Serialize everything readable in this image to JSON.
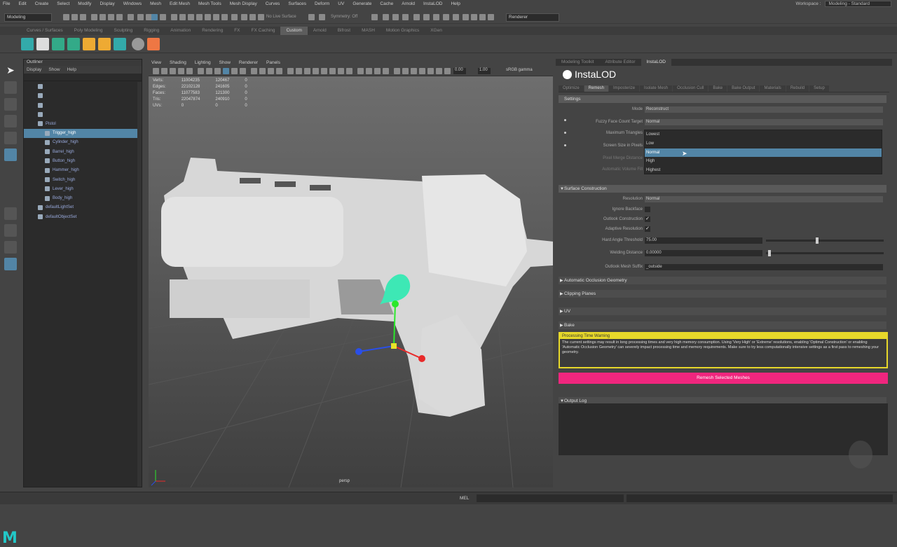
{
  "menubar": [
    "File",
    "Edit",
    "Create",
    "Select",
    "Modify",
    "Display",
    "Windows",
    "Mesh",
    "Edit Mesh",
    "Mesh Tools",
    "Mesh Display",
    "Curves",
    "Surfaces",
    "Deform",
    "UV",
    "Generate",
    "Cache",
    "Arnold",
    "InstaLOD",
    "Help"
  ],
  "workspace": {
    "label": "Workspace :",
    "value": "Modeling - Standard"
  },
  "statusline": {
    "mode": "Modeling",
    "no_live": "No Live Surface",
    "symmetry": "Symmetry: Off",
    "renderer": "Renderer"
  },
  "shelf_tabs": [
    "Curves / Surfaces",
    "Poly Modeling",
    "Sculpting",
    "Rigging",
    "Animation",
    "Rendering",
    "FX",
    "FX Caching",
    "Custom",
    "Arnold",
    "Bifrost",
    "MASH",
    "Motion Graphics",
    "XGen"
  ],
  "shelf_active": "Custom",
  "outliner": {
    "title": "Outliner",
    "menu": [
      "Display",
      "Show",
      "Help"
    ],
    "items": [
      {
        "label": "",
        "indent": 1,
        "selected": false
      },
      {
        "label": "",
        "indent": 1,
        "selected": false
      },
      {
        "label": "",
        "indent": 1,
        "selected": false
      },
      {
        "label": "",
        "indent": 1,
        "selected": false
      },
      {
        "label": "Pistol",
        "indent": 1,
        "selected": false
      },
      {
        "label": "Trigger_high",
        "indent": 2,
        "selected": true
      },
      {
        "label": "Cylinder_high",
        "indent": 2,
        "selected": false
      },
      {
        "label": "Barrel_high",
        "indent": 2,
        "selected": false
      },
      {
        "label": "Button_high",
        "indent": 2,
        "selected": false
      },
      {
        "label": "Hammer_high",
        "indent": 2,
        "selected": false
      },
      {
        "label": "Switch_high",
        "indent": 2,
        "selected": false
      },
      {
        "label": "Lever_high",
        "indent": 2,
        "selected": false
      },
      {
        "label": "Body_high",
        "indent": 2,
        "selected": false
      },
      {
        "label": "defaultLightSet",
        "indent": 1,
        "selected": false
      },
      {
        "label": "defaultObjectSet",
        "indent": 1,
        "selected": false
      }
    ]
  },
  "viewport": {
    "menu": [
      "View",
      "Shading",
      "Lighting",
      "Show",
      "Renderer",
      "Panels"
    ],
    "gamma": "sRGB gamma",
    "field1": "0.00",
    "field2": "1.00",
    "hud": [
      {
        "label": "Verts:",
        "a": "11004235",
        "b": "120467",
        "c": "0"
      },
      {
        "label": "Edges:",
        "a": "22102128",
        "b": "241605",
        "c": "0"
      },
      {
        "label": "Faces:",
        "a": "11077583",
        "b": "121300",
        "c": "0"
      },
      {
        "label": "Tris:",
        "a": "22047874",
        "b": "240910",
        "c": "0"
      },
      {
        "label": "UVs:",
        "a": "0",
        "b": "0",
        "c": "0"
      }
    ],
    "camera": "persp"
  },
  "right_panel": {
    "tabs": [
      "Modeling Toolkit",
      "Attribute Editor",
      "InstaLOD"
    ],
    "active_tab": "InstaLOD",
    "logo": "InstaLOD",
    "tool_tabs": [
      "Optimize",
      "Remesh",
      "Imposterize",
      "Isolate Mesh",
      "Occlusion Cull",
      "Bake",
      "Bake Output",
      "Materials",
      "Rebuild",
      "Setup"
    ],
    "active_tool_tab": "Remesh",
    "settings_title": "Settings",
    "mode_label": "Mode",
    "mode_value": "Reconstruct",
    "fuzzy_label": "Fuzzy Face Count Target",
    "fuzzy_value": "Normal",
    "max_tri_label": "Maximum Triangles",
    "screen_size_label": "Screen Size in Pixels",
    "pixel_merge_label": "Pixel Merge Distance",
    "auto_weld_label": "Automatic Volume Fill",
    "dropdown_options": [
      "Lowest",
      "Low",
      "Normal",
      "High",
      "Highest"
    ],
    "dropdown_highlight": "Normal",
    "surface_section": "Surface Construction",
    "resolution_label": "Resolution",
    "resolution_value": "Normal",
    "ignore_backface_label": "Ignore Backface",
    "outlook_label": "Outlook Construction",
    "adaptive_label": "Adaptive Resolution",
    "hard_angle_label": "Hard Angle Threshold",
    "hard_angle_value": "75.00",
    "hard_angle_fraction": 0.42,
    "welding_label": "Welding Distance",
    "welding_value": "0.00000",
    "welding_fraction": 0.02,
    "suffix_label": "Outlook Mesh Suffix",
    "suffix_value": "_outside",
    "sections": [
      "Automatic Occlusion Geometry",
      "Clipping Planes",
      "UV",
      "Bake"
    ],
    "warning_title": "Processing Time Warning",
    "warning_text": "The current settings may result in long processing times and very high memory consumption. Using 'Very High' or 'Extreme' resolutions, enabling 'Optimal Construction' or enabling 'Automatic Occlusion Geometry' can severely impact processing time and memory requirements. Make sure to try less computationally intensive settings as a first pass to remeshing your geometry.",
    "remesh_button": "Remesh Selected Meshes",
    "output_section": "Output Log"
  },
  "colors": {
    "accent": "#5285a6",
    "remesh_button": "#f0267e",
    "warning": "#e7d82a",
    "maya_logo": "#22c7c7"
  },
  "cmdline": {
    "label": "MEL"
  }
}
